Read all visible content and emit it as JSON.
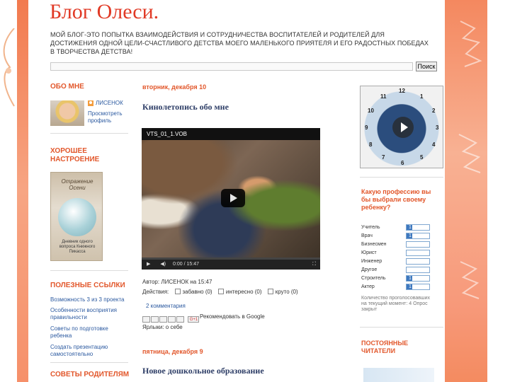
{
  "blog": {
    "title": "Блог Олеси.",
    "description": "МОЙ БЛОГ-ЭТО ПОПЫТКА ВЗАИМОДЕЙСТВИЯ И СОТРУДНИЧЕСТВА ВОСПИТАТЕЛЕЙ И РОДИТЕЛЕЙ ДЛЯ ДОСТИЖЕНИЯ ОДНОЙ ЦЕЛИ-СЧАСТЛИВОГО ДЕТСТВА МОЕГО МАЛЕНЬКОГО ПРИЯТЕЛЯ И ЕГО РАДОСТНЫХ ПОБЕДАХ В ТВОРЧЕСТВА ДЕТСТВА!",
    "search_button": "Поиск"
  },
  "sidebar_left": {
    "about_heading": "ОБО МНЕ",
    "profile_name": "ЛИСЕНОК",
    "profile_link": "Просмотреть профиль",
    "mood_heading": "ХОРОШЕЕ НАСТРОЕНИЕ",
    "book_title": "Отражение Осени",
    "book_caption": "Дневник одного вопроса Книжного Пикасса",
    "links_heading": "ПОЛЕЗНЫЕ ССЫЛКИ",
    "links": [
      "Возможность 3 из 3 проекта",
      "Особенности восприятия правильности",
      "Советы по подготовке ребенка",
      "Создать презентацию самостоятельно"
    ],
    "advice_heading": "СОВЕТЫ РОДИТЕЛЯМ"
  },
  "post1": {
    "date": "вторник, декабря 10",
    "title": "Кинолетопись обо мне",
    "video_file": "VTS_01_1.VOB",
    "video_time": "0:00 / 15:47",
    "author_line": "Автор: ЛИСЕНОК на 15:47",
    "actions_label": "Действия:",
    "reactions": [
      "забавно (0)",
      "интересно (0)",
      "круто (0)"
    ],
    "comments": "2 комментария",
    "gplus": "G+1",
    "recommend": "Рекомендовать в Google",
    "labels": "Ярлыки: о себе"
  },
  "post2": {
    "date": "пятница, декабря 9",
    "title": "Новое дошкольное образование"
  },
  "sidebar_right": {
    "clock_numbers": [
      "12",
      "1",
      "2",
      "3",
      "4",
      "5",
      "6",
      "7",
      "8",
      "9",
      "10",
      "11"
    ],
    "poll_question": "Какую профессию вы бы выбрали своему ребенку?",
    "poll_options": [
      {
        "label": "Учитель",
        "count": "1",
        "fraction": 0.25
      },
      {
        "label": "Врач",
        "count": "1",
        "fraction": 0.25
      },
      {
        "label": "Бизнесмен",
        "count": "",
        "fraction": 0
      },
      {
        "label": "Юрист",
        "count": "",
        "fraction": 0
      },
      {
        "label": "Инженер",
        "count": "",
        "fraction": 0
      },
      {
        "label": "Другое",
        "count": "",
        "fraction": 0
      },
      {
        "label": "Строитель",
        "count": "1",
        "fraction": 0.25
      },
      {
        "label": "Актер",
        "count": "1",
        "fraction": 0.25
      }
    ],
    "poll_footer": "Количество проголосовавших на текущий момент: 4 Опрос закрыт",
    "readers_heading": "ПОСТОЯННЫЕ ЧИТАТЕЛИ"
  }
}
